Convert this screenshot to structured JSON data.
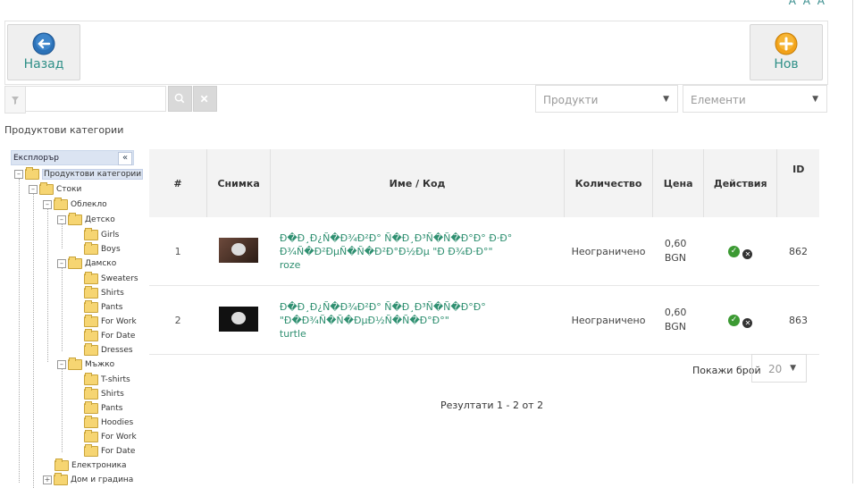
{
  "font_sizes": "A A A",
  "toolbar": {
    "back_label": "Назад",
    "new_label": "Нов"
  },
  "filter": {
    "search_value": "",
    "products_select": "Продукти",
    "elements_select": "Елементи"
  },
  "section_title": "Продуктови категории",
  "tree": {
    "header": "Експлорър",
    "collapse": "«",
    "nodes": [
      {
        "label": "Продуктови категории"
      },
      {
        "label": "Стоки"
      },
      {
        "label": "Облекло"
      },
      {
        "label": "Детско"
      },
      {
        "label": "Girls"
      },
      {
        "label": "Boys"
      },
      {
        "label": "Дамско"
      },
      {
        "label": "Sweaters"
      },
      {
        "label": "Shirts"
      },
      {
        "label": "Pants"
      },
      {
        "label": "For Work"
      },
      {
        "label": "For Date"
      },
      {
        "label": "Dresses"
      },
      {
        "label": "Мъжко"
      },
      {
        "label": "T-shirts"
      },
      {
        "label": "Shirts"
      },
      {
        "label": "Pants"
      },
      {
        "label": "Hoodies"
      },
      {
        "label": "For Work"
      },
      {
        "label": "For Date"
      },
      {
        "label": "Електроника"
      },
      {
        "label": "Дом и градина"
      }
    ]
  },
  "table": {
    "headers": {
      "num": "#",
      "image": "Снимка",
      "name": "Име / Код",
      "qty": "Количество",
      "price": "Цена",
      "actions": "Действия",
      "id": "ID"
    },
    "rows": [
      {
        "num": "1",
        "name": "Ð�Ð¸Ð¿Ñ�Ð¾Ð²Ð° Ñ�Ð¸Ð³Ñ�Ñ�Ð°Ð° Ð·Ð° Ð¾Ñ�Ð²ÐµÑ�Ñ�Ð²Ð°Ð½Ðµ \"Ð Ð¾Ð·Ð°\"",
        "code": "roze",
        "qty": "Неограничено",
        "price": "0,60",
        "currency": "BGN",
        "id": "862"
      },
      {
        "num": "2",
        "name": "Ð�Ð¸Ð¿Ñ�Ð¾Ð²Ð° Ñ�Ð¸Ð³Ñ�Ñ�Ð°Ð° \"Ð�Ð¾Ñ�Ñ�ÐµÐ½Ñ�Ñ�Ð°Ð°\"",
        "code": "turtle",
        "qty": "Неограничено",
        "price": "0,60",
        "currency": "BGN",
        "id": "863"
      }
    ]
  },
  "pager": {
    "label": "Покажи брой",
    "value": "20",
    "results": "Резултати 1 - 2 от 2"
  }
}
